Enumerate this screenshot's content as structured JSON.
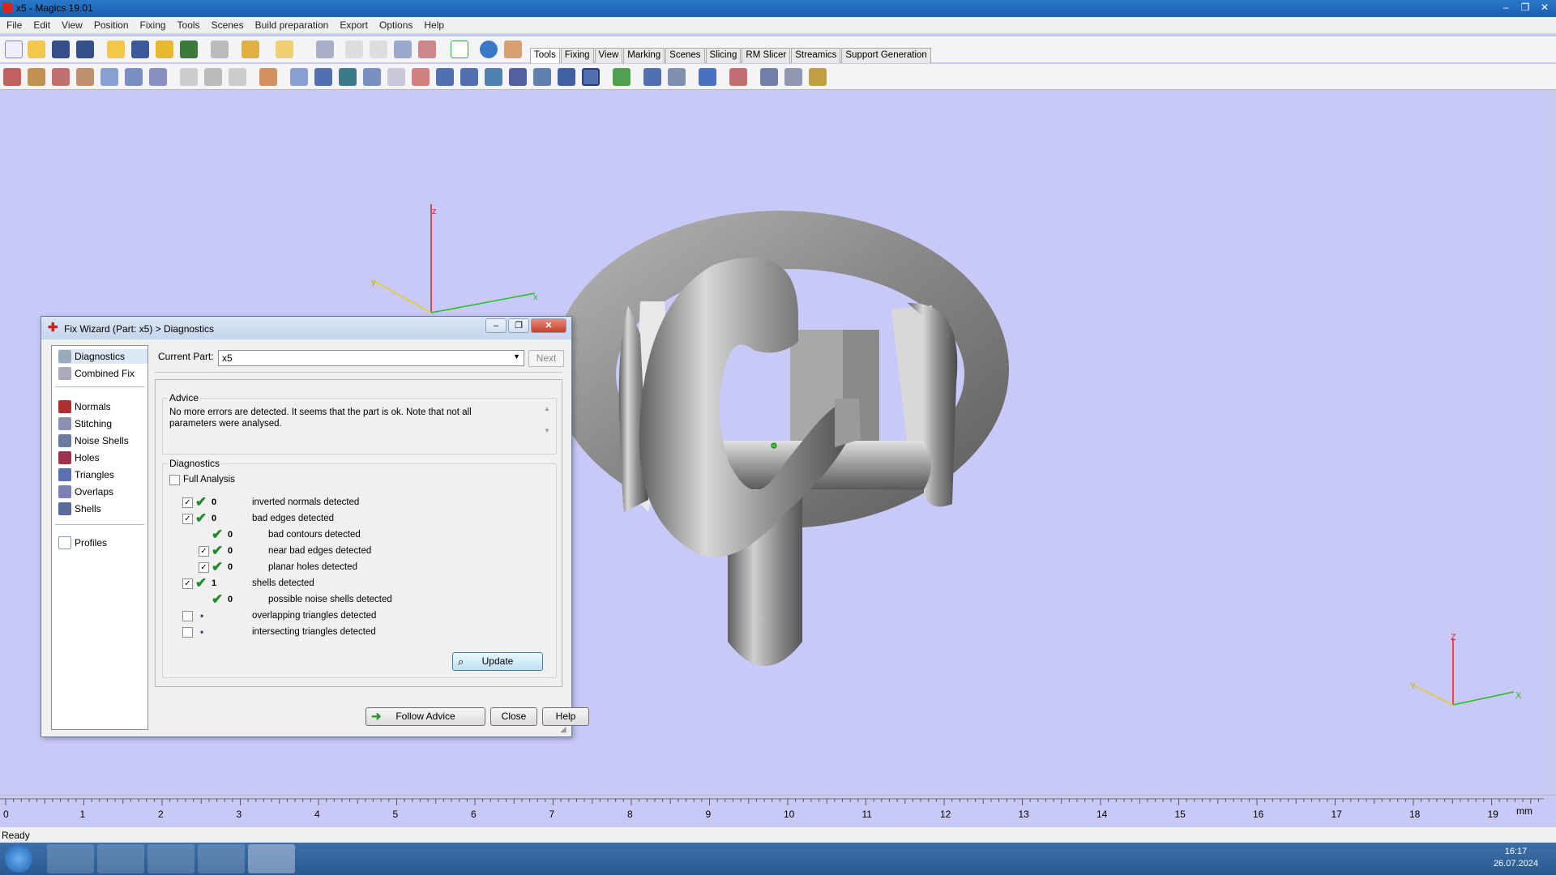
{
  "window": {
    "title": "x5 - Magics 19.01",
    "controls": [
      "–",
      "❐",
      "✕"
    ]
  },
  "menu": [
    "File",
    "Edit",
    "View",
    "Position",
    "Fixing",
    "Tools",
    "Scenes",
    "Build preparation",
    "Export",
    "Options",
    "Help"
  ],
  "ribbon_tabs": [
    "Tools",
    "Fixing",
    "View",
    "Marking",
    "Scenes",
    "Slicing",
    "RM Slicer",
    "Streamics",
    "Support Generation"
  ],
  "viewport": {
    "axis_z": "z",
    "axis_x": "x",
    "axis_y": "y",
    "mini_z": "Z",
    "mini_x": "X",
    "mini_y": "Y",
    "background": "#c9c9f8"
  },
  "ruler": {
    "labels": [
      "0",
      "1",
      "2",
      "3",
      "4",
      "5",
      "6",
      "7",
      "8",
      "9",
      "10",
      "11",
      "12",
      "13",
      "14",
      "15",
      "16",
      "17",
      "18",
      "19"
    ],
    "unit": "mm"
  },
  "status": {
    "text": "Ready"
  },
  "clock": {
    "time": "16:17",
    "date": "26.07.2024"
  },
  "dialog": {
    "title": "Fix Wizard (Part: x5) > Diagnostics",
    "left_items": {
      "diagnostics": "Diagnostics",
      "combined_fix": "Combined Fix",
      "normals": "Normals",
      "stitching": "Stitching",
      "noise_shells": "Noise Shells",
      "holes": "Holes",
      "triangles": "Triangles",
      "overlaps": "Overlaps",
      "shells": "Shells",
      "profiles": "Profiles"
    },
    "current_part_label": "Current Part:",
    "current_part_value": "x5",
    "next_label": "Next",
    "advice_title": "Advice",
    "advice_text": "No more errors are detected. It seems that the part is ok. Note that not all parameters were analysed.",
    "diagnostics_title": "Diagnostics",
    "full_analysis_label": "Full Analysis",
    "rows": [
      {
        "count": "0",
        "label": "inverted normals detected"
      },
      {
        "count": "0",
        "label": "bad edges detected"
      },
      {
        "count": "0",
        "label": "bad contours detected"
      },
      {
        "count": "0",
        "label": "near bad edges detected"
      },
      {
        "count": "0",
        "label": "planar holes detected"
      },
      {
        "count": "1",
        "label": "shells detected"
      },
      {
        "count": "0",
        "label": "possible noise shells detected"
      },
      {
        "count": "•",
        "label": "overlapping triangles detected"
      },
      {
        "count": "•",
        "label": "intersecting triangles detected"
      }
    ],
    "update_label": "Update",
    "follow_advice_label": "Follow Advice",
    "close_label": "Close",
    "help_label": "Help"
  }
}
